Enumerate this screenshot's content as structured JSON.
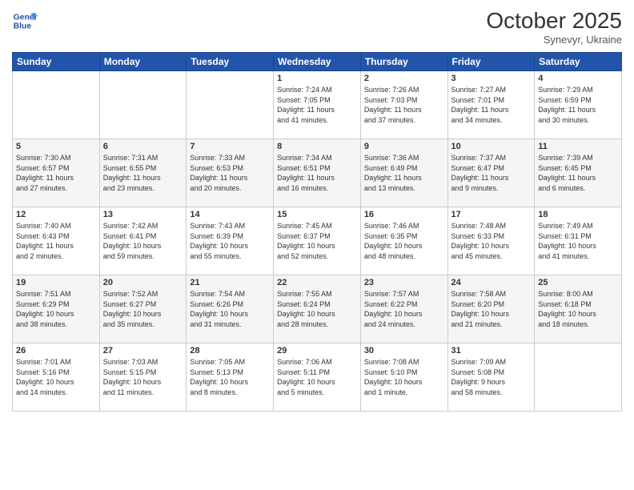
{
  "logo": {
    "line1": "General",
    "line2": "Blue"
  },
  "title": "October 2025",
  "subtitle": "Synevyr, Ukraine",
  "days_header": [
    "Sunday",
    "Monday",
    "Tuesday",
    "Wednesday",
    "Thursday",
    "Friday",
    "Saturday"
  ],
  "weeks": [
    [
      {
        "day": "",
        "info": ""
      },
      {
        "day": "",
        "info": ""
      },
      {
        "day": "",
        "info": ""
      },
      {
        "day": "1",
        "info": "Sunrise: 7:24 AM\nSunset: 7:05 PM\nDaylight: 11 hours\nand 41 minutes."
      },
      {
        "day": "2",
        "info": "Sunrise: 7:26 AM\nSunset: 7:03 PM\nDaylight: 11 hours\nand 37 minutes."
      },
      {
        "day": "3",
        "info": "Sunrise: 7:27 AM\nSunset: 7:01 PM\nDaylight: 11 hours\nand 34 minutes."
      },
      {
        "day": "4",
        "info": "Sunrise: 7:29 AM\nSunset: 6:59 PM\nDaylight: 11 hours\nand 30 minutes."
      }
    ],
    [
      {
        "day": "5",
        "info": "Sunrise: 7:30 AM\nSunset: 6:57 PM\nDaylight: 11 hours\nand 27 minutes."
      },
      {
        "day": "6",
        "info": "Sunrise: 7:31 AM\nSunset: 6:55 PM\nDaylight: 11 hours\nand 23 minutes."
      },
      {
        "day": "7",
        "info": "Sunrise: 7:33 AM\nSunset: 6:53 PM\nDaylight: 11 hours\nand 20 minutes."
      },
      {
        "day": "8",
        "info": "Sunrise: 7:34 AM\nSunset: 6:51 PM\nDaylight: 11 hours\nand 16 minutes."
      },
      {
        "day": "9",
        "info": "Sunrise: 7:36 AM\nSunset: 6:49 PM\nDaylight: 11 hours\nand 13 minutes."
      },
      {
        "day": "10",
        "info": "Sunrise: 7:37 AM\nSunset: 6:47 PM\nDaylight: 11 hours\nand 9 minutes."
      },
      {
        "day": "11",
        "info": "Sunrise: 7:39 AM\nSunset: 6:45 PM\nDaylight: 11 hours\nand 6 minutes."
      }
    ],
    [
      {
        "day": "12",
        "info": "Sunrise: 7:40 AM\nSunset: 6:43 PM\nDaylight: 11 hours\nand 2 minutes."
      },
      {
        "day": "13",
        "info": "Sunrise: 7:42 AM\nSunset: 6:41 PM\nDaylight: 10 hours\nand 59 minutes."
      },
      {
        "day": "14",
        "info": "Sunrise: 7:43 AM\nSunset: 6:39 PM\nDaylight: 10 hours\nand 55 minutes."
      },
      {
        "day": "15",
        "info": "Sunrise: 7:45 AM\nSunset: 6:37 PM\nDaylight: 10 hours\nand 52 minutes."
      },
      {
        "day": "16",
        "info": "Sunrise: 7:46 AM\nSunset: 6:35 PM\nDaylight: 10 hours\nand 48 minutes."
      },
      {
        "day": "17",
        "info": "Sunrise: 7:48 AM\nSunset: 6:33 PM\nDaylight: 10 hours\nand 45 minutes."
      },
      {
        "day": "18",
        "info": "Sunrise: 7:49 AM\nSunset: 6:31 PM\nDaylight: 10 hours\nand 41 minutes."
      }
    ],
    [
      {
        "day": "19",
        "info": "Sunrise: 7:51 AM\nSunset: 6:29 PM\nDaylight: 10 hours\nand 38 minutes."
      },
      {
        "day": "20",
        "info": "Sunrise: 7:52 AM\nSunset: 6:27 PM\nDaylight: 10 hours\nand 35 minutes."
      },
      {
        "day": "21",
        "info": "Sunrise: 7:54 AM\nSunset: 6:26 PM\nDaylight: 10 hours\nand 31 minutes."
      },
      {
        "day": "22",
        "info": "Sunrise: 7:55 AM\nSunset: 6:24 PM\nDaylight: 10 hours\nand 28 minutes."
      },
      {
        "day": "23",
        "info": "Sunrise: 7:57 AM\nSunset: 6:22 PM\nDaylight: 10 hours\nand 24 minutes."
      },
      {
        "day": "24",
        "info": "Sunrise: 7:58 AM\nSunset: 6:20 PM\nDaylight: 10 hours\nand 21 minutes."
      },
      {
        "day": "25",
        "info": "Sunrise: 8:00 AM\nSunset: 6:18 PM\nDaylight: 10 hours\nand 18 minutes."
      }
    ],
    [
      {
        "day": "26",
        "info": "Sunrise: 7:01 AM\nSunset: 5:16 PM\nDaylight: 10 hours\nand 14 minutes."
      },
      {
        "day": "27",
        "info": "Sunrise: 7:03 AM\nSunset: 5:15 PM\nDaylight: 10 hours\nand 11 minutes."
      },
      {
        "day": "28",
        "info": "Sunrise: 7:05 AM\nSunset: 5:13 PM\nDaylight: 10 hours\nand 8 minutes."
      },
      {
        "day": "29",
        "info": "Sunrise: 7:06 AM\nSunset: 5:11 PM\nDaylight: 10 hours\nand 5 minutes."
      },
      {
        "day": "30",
        "info": "Sunrise: 7:08 AM\nSunset: 5:10 PM\nDaylight: 10 hours\nand 1 minute."
      },
      {
        "day": "31",
        "info": "Sunrise: 7:09 AM\nSunset: 5:08 PM\nDaylight: 9 hours\nand 58 minutes."
      },
      {
        "day": "",
        "info": ""
      }
    ]
  ]
}
